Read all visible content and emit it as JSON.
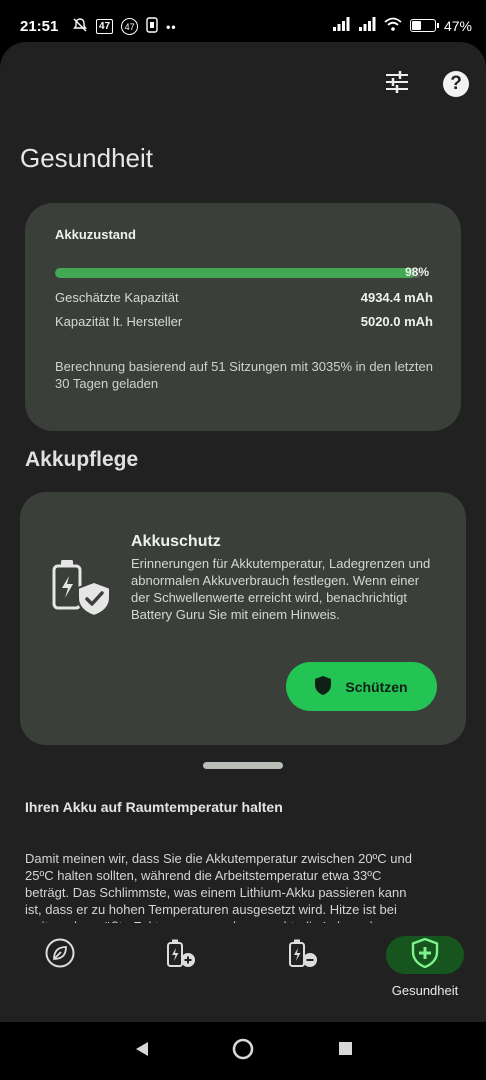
{
  "status_bar": {
    "time": "21:51",
    "notif_box": "47",
    "notif_circle": "47",
    "battery_text": "47%",
    "battery_level": 0.47
  },
  "header": {
    "title": "Gesundheit",
    "icons": [
      "tune-icon",
      "help-icon"
    ],
    "help_glyph": "?"
  },
  "battery_health": {
    "title": "Akkuzustand",
    "percent_label": "98%",
    "percent_value": 98,
    "estimated_capacity_label": "Geschätzte Kapazität",
    "estimated_capacity_value": "4934.4 mAh",
    "rated_capacity_label": "Kapazität lt. Hersteller",
    "rated_capacity_value": "5020.0 mAh",
    "note": "Berechnung basierend auf 51 Sitzungen mit 3035% in den letzten 30 Tagen geladen"
  },
  "care_section": {
    "title": "Akkupflege",
    "card": {
      "title": "Akkuschutz",
      "description": "Erinnerungen für Akkutemperatur, Ladegrenzen und abnormalen Akkuverbrauch festlegen. Wenn einer der Schwellenwerte erreicht wird, benachrichtigt Battery Guru Sie mit einem Hinweis.",
      "button_label": "Schützen",
      "icon": "battery-shield-icon"
    }
  },
  "article": {
    "title": "Ihren Akku auf Raumtemperatur halten",
    "body": "Damit meinen wir, dass Sie die Akkutemperatur zwischen 20ºC und 25ºC halten sollten, während die Arbeitstemperatur etwa 33ºC beträgt. Das Schlimmste, was einem Lithium-Akku passieren kann ist, dass er zu hohen Temperaturen ausgesetzt wird. Hitze ist bei weitem der größte Faktor, wenn es darum geht, die Lebensdauer von"
  },
  "bottom_nav": {
    "items": [
      {
        "icon": "leaf-icon",
        "label": ""
      },
      {
        "icon": "battery-charging-plus-icon",
        "label": ""
      },
      {
        "icon": "battery-minus-icon",
        "label": ""
      },
      {
        "icon": "health-shield-icon",
        "label": "Gesundheit",
        "active": true
      }
    ]
  },
  "colors": {
    "accent_green": "#23c354",
    "progress_green": "#44a852",
    "card_bg": "#3a3f3a",
    "app_bg": "#212121"
  }
}
